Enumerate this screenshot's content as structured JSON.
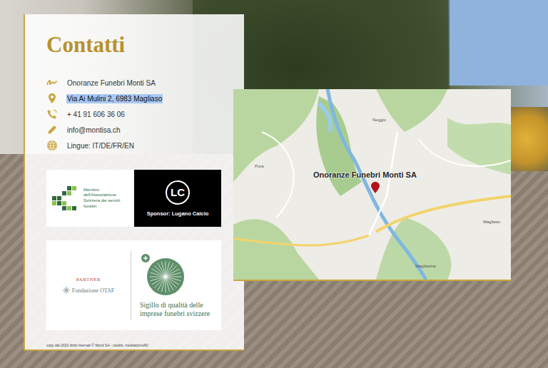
{
  "title": "Contatti",
  "contacts": [
    {
      "kind": "name",
      "text": "Onoranze Funebri Monti SA",
      "selected": false
    },
    {
      "kind": "address",
      "text": "Via Ai Mulini 2, 6983 Magliaso",
      "selected": true
    },
    {
      "kind": "phone",
      "text": "+ 41 91 606 36 06",
      "selected": false
    },
    {
      "kind": "email",
      "text": "info@montisa.ch",
      "selected": false
    },
    {
      "kind": "languages",
      "text": "Lingue: IT/DE/FR/EN",
      "selected": false
    }
  ],
  "association": "Membro dell'Associazione Svizzera dei servizi funebri",
  "sponsor": {
    "logo": "LC",
    "label": "Sponsor: Lugano Calcio"
  },
  "partner": {
    "label": "PARTNER",
    "name": "Fondazione OTAF",
    "seal": "Sigillo di qualità delle imprese funebri svizzere"
  },
  "footer": "copy dal 2022 diritti riservati © Monti SA - credits: mediaticinoAD",
  "map": {
    "label": "Onoranze Funebri Monti SA",
    "places": [
      "Pura",
      "Neggio",
      "Magliaso",
      "Magliasina"
    ]
  }
}
